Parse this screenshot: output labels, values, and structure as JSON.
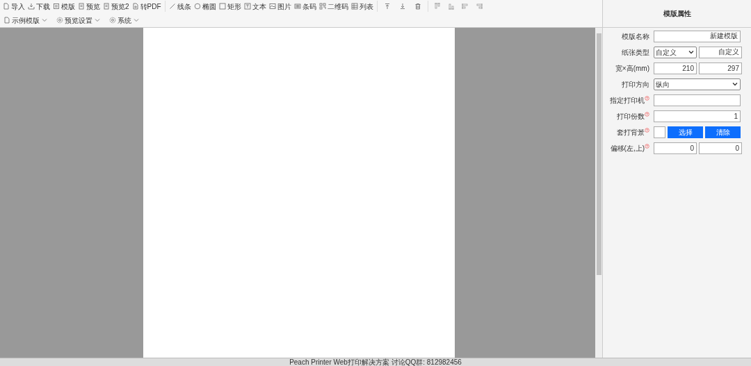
{
  "toolbar": {
    "groups": [
      {
        "items": [
          {
            "label": "导入"
          },
          {
            "label": "下载"
          },
          {
            "label": "模版"
          },
          {
            "label": "预览"
          },
          {
            "label": "预览2"
          },
          {
            "label": "转PDF"
          }
        ]
      },
      {
        "items": [
          {
            "label": "线条"
          },
          {
            "label": "椭圆"
          },
          {
            "label": "矩形"
          },
          {
            "label": "文本"
          },
          {
            "label": "图片"
          },
          {
            "label": "条码"
          },
          {
            "label": "二维码"
          },
          {
            "label": "列表"
          }
        ]
      }
    ],
    "menus": [
      {
        "label": "示例模版"
      },
      {
        "label": "预览设置"
      },
      {
        "label": "系统"
      }
    ]
  },
  "panel": {
    "title": "模版属性",
    "fields": [
      {
        "kind": "text",
        "label": "模版名称",
        "help": false,
        "value": "新建模版"
      },
      {
        "kind": "select_text",
        "label": "纸张类型",
        "help": false,
        "value": "自定义",
        "value_2": "自定义"
      },
      {
        "kind": "pair",
        "label": "宽×高(mm)",
        "help": false,
        "value": "210",
        "value_2": "297"
      },
      {
        "kind": "select",
        "label": "打印方向",
        "help": false,
        "value": "纵向"
      },
      {
        "kind": "text",
        "label": "指定打印机",
        "help": true
      },
      {
        "kind": "text",
        "label": "打印份数",
        "help": true,
        "value": "1"
      },
      {
        "kind": "file",
        "label": "套打背景",
        "help": true,
        "button": "选择",
        "button_2": "清除"
      },
      {
        "kind": "pair",
        "label": "偏移(左,上)",
        "help": true,
        "value": "0",
        "value_2": "0"
      }
    ]
  },
  "status_bar": {
    "text": "Peach Printer Web打印解决方案 讨论QQ群: 812982456"
  }
}
